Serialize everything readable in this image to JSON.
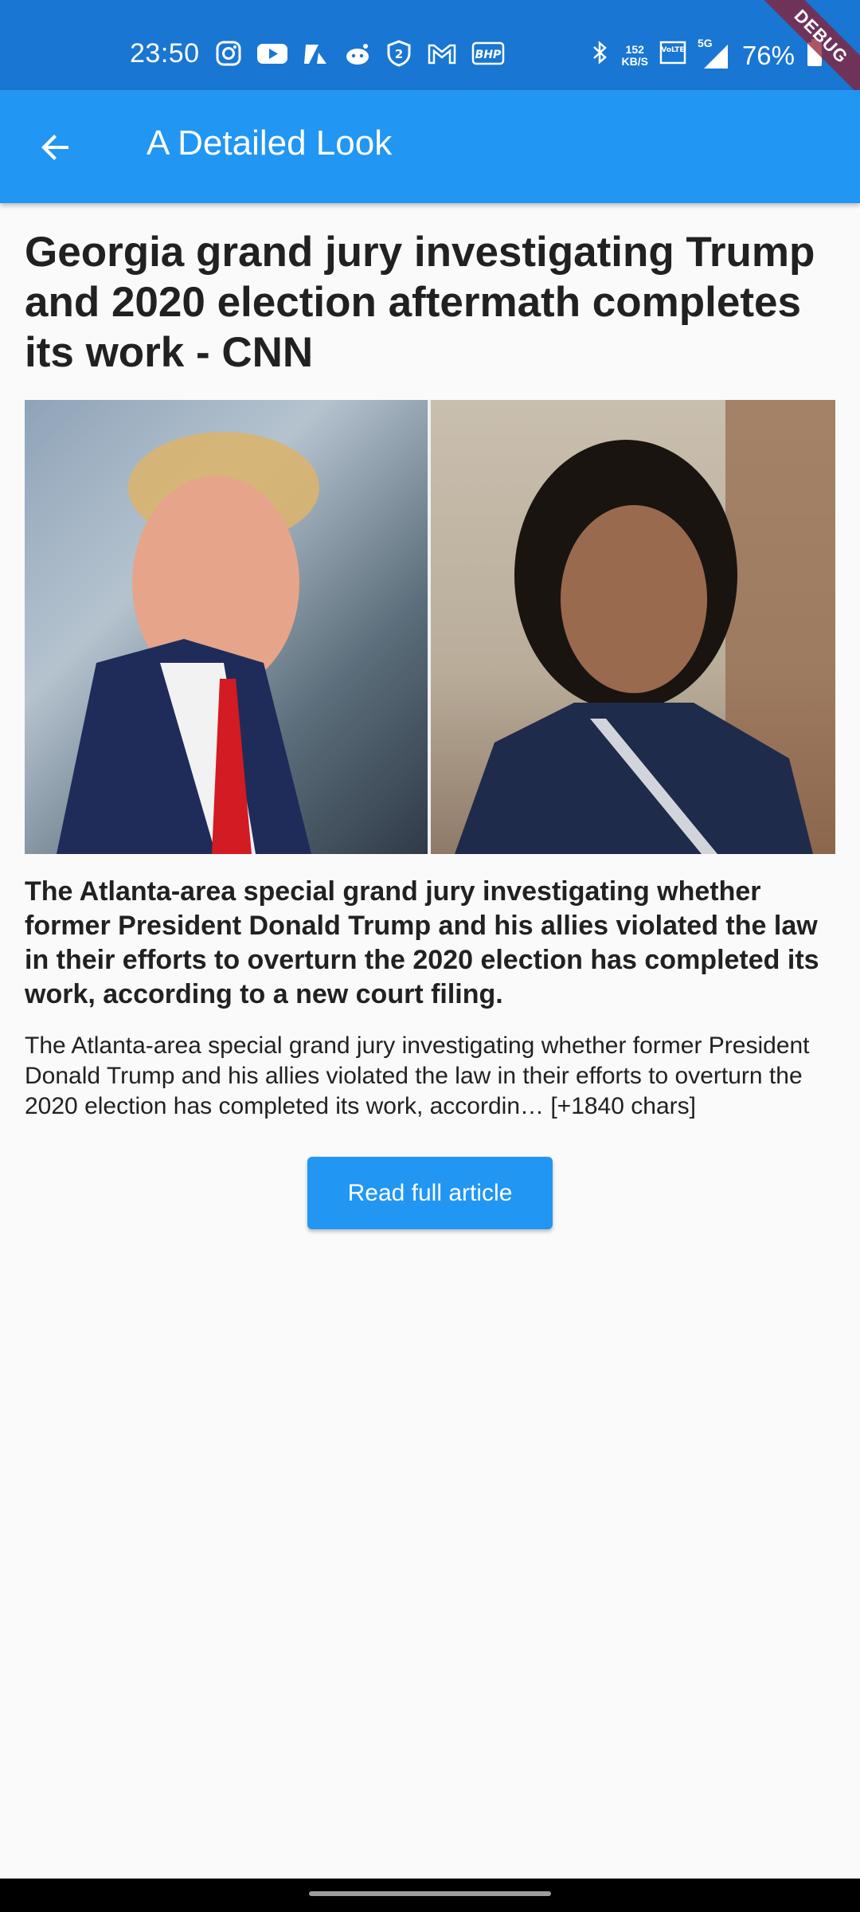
{
  "status_bar": {
    "time": "23:50",
    "left_icons": [
      "instagram-icon",
      "youtube-icon",
      "app-icon",
      "reddit-icon",
      "shield-icon",
      "gmail-icon",
      "bhp-icon"
    ],
    "net_speed_value": "152",
    "net_speed_unit": "KB/S",
    "network": "5G",
    "battery": "76%",
    "debug_label": "DEBUG"
  },
  "app_bar": {
    "title": "A Detailed Look",
    "back_icon": "arrow-back-icon",
    "color": "#2196f3"
  },
  "article": {
    "title": "Georgia grand jury investigating Trump and 2020 election aftermath completes its work - CNN",
    "description": "The Atlanta-area special grand jury investigating whether former President Donald Trump and his allies violated the law in their efforts to overturn the 2020 election has completed its work, according to a new court filing.",
    "content": "The Atlanta-area special grand jury investigating whether former President Donald Trump and his allies violated the law in their efforts to overturn the 2020 election has completed its work, accordin… [+1840 chars]",
    "read_button_label": "Read full article"
  }
}
